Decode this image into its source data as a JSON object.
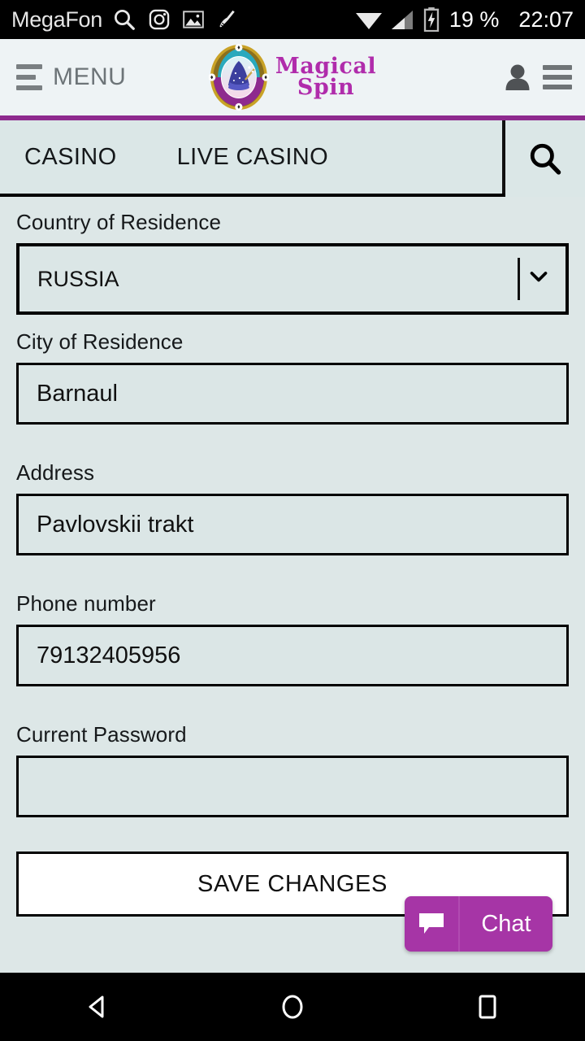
{
  "status_bar": {
    "carrier": "MegaFon",
    "icons": [
      "search-icon",
      "instagram-icon",
      "gallery-icon",
      "broom-icon"
    ],
    "right_icons": [
      "wifi-icon",
      "signal-icon",
      "battery-charging-icon"
    ],
    "battery_percent": "19 %",
    "clock": "22:07"
  },
  "header": {
    "menu_label": "MENU",
    "brand_line1": "Magical",
    "brand_line2": "Spin",
    "account_icon": "person-icon",
    "nav_toggle_icon": "hamburger-icon"
  },
  "nav": {
    "items": [
      {
        "label": "CASINO"
      },
      {
        "label": "LIVE CASINO"
      }
    ],
    "search_icon": "search-icon"
  },
  "form": {
    "fields": [
      {
        "label": "Country of Residence",
        "type": "select",
        "value": "RUSSIA",
        "placeholder": ""
      },
      {
        "label": "City of Residence",
        "type": "text",
        "value": "Barnaul",
        "placeholder": ""
      },
      {
        "label": "Address",
        "type": "text",
        "value": "Pavlovskii trakt",
        "placeholder": ""
      },
      {
        "label": "Phone number",
        "type": "text",
        "value": "79132405956",
        "placeholder": ""
      },
      {
        "label": "Current Password",
        "type": "password",
        "value": "",
        "placeholder": ""
      }
    ],
    "save_label": "SAVE CHANGES"
  },
  "chat": {
    "label": "Chat",
    "icon": "speech-bubble-icon"
  },
  "system_nav": {
    "back": "back-icon",
    "home": "home-icon",
    "recents": "recents-icon"
  },
  "colors": {
    "page_bg": "#dde7e7",
    "header_bg": "#eef3f5",
    "accent_purple": "#8e2a8e",
    "brand_purple": "#b02cab",
    "chat_purple": "#a635a6"
  }
}
